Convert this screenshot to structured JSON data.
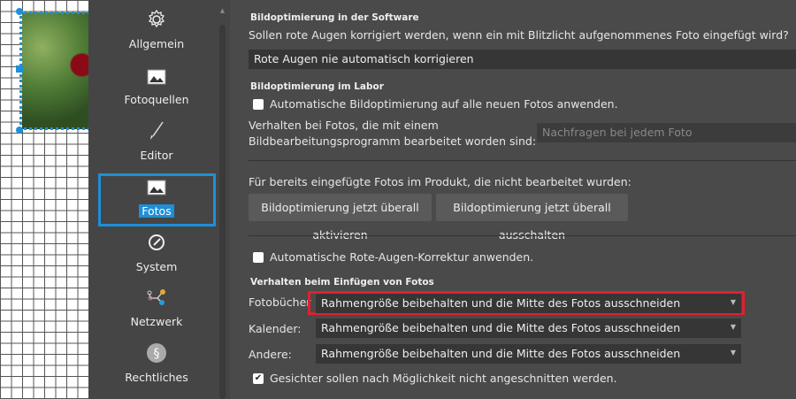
{
  "sidebar": {
    "items": [
      {
        "label": "Allgemein",
        "icon": "gear-icon"
      },
      {
        "label": "Fotoquellen",
        "icon": "image-icon"
      },
      {
        "label": "Editor",
        "icon": "brush-icon"
      },
      {
        "label": "Fotos",
        "icon": "image-icon",
        "selected": true
      },
      {
        "label": "System",
        "icon": "gauge-icon"
      },
      {
        "label": "Netzwerk",
        "icon": "network-icon"
      },
      {
        "label": "Rechtliches",
        "icon": "paragraph-icon"
      }
    ]
  },
  "software": {
    "heading": "Bildoptimierung in der Software",
    "question": "Sollen rote Augen korrigiert werden, wenn ein mit Blitzlicht aufgenommenes Foto eingefügt wird?",
    "redeye_select": "Rote Augen nie automatisch korrigieren"
  },
  "labor": {
    "heading": "Bildoptimierung im Labor",
    "auto_checkbox": "Automatische Bildoptimierung auf alle neuen Fotos anwenden.",
    "auto_checked": false,
    "edited_label_1": "Verhalten bei Fotos, die mit einem",
    "edited_label_2": "Bildbearbeitungsprogramm bearbeitet worden sind:",
    "edited_select": "Nachfragen bei jedem Foto",
    "existing_text": "Für bereits eingefügte Fotos im Produkt, die nicht bearbeitet wurden:",
    "btn_activate": "Bildoptimierung jetzt überall aktivieren",
    "btn_disable": "Bildoptimierung jetzt überall ausschalten",
    "redeye_checkbox": "Automatische Rote-Augen-Korrektur anwenden.",
    "redeye_checked": false
  },
  "insert": {
    "heading": "Verhalten beim Einfügen von Fotos",
    "rows": [
      {
        "label": "Fotobücher",
        "value": "Rahmengröße beibehalten und die Mitte des Fotos ausschneiden"
      },
      {
        "label": "Kalender:",
        "value": "Rahmengröße beibehalten und die Mitte des Fotos ausschneiden"
      },
      {
        "label": "Andere:",
        "value": "Rahmengröße beibehalten und die Mitte des Fotos ausschneiden"
      }
    ],
    "faces_checkbox": "Gesichter sollen nach Möglichkeit nicht angeschnitten werden.",
    "faces_checked": true
  },
  "colors": {
    "accent": "#1e8fd8",
    "highlight": "#e0202e"
  }
}
